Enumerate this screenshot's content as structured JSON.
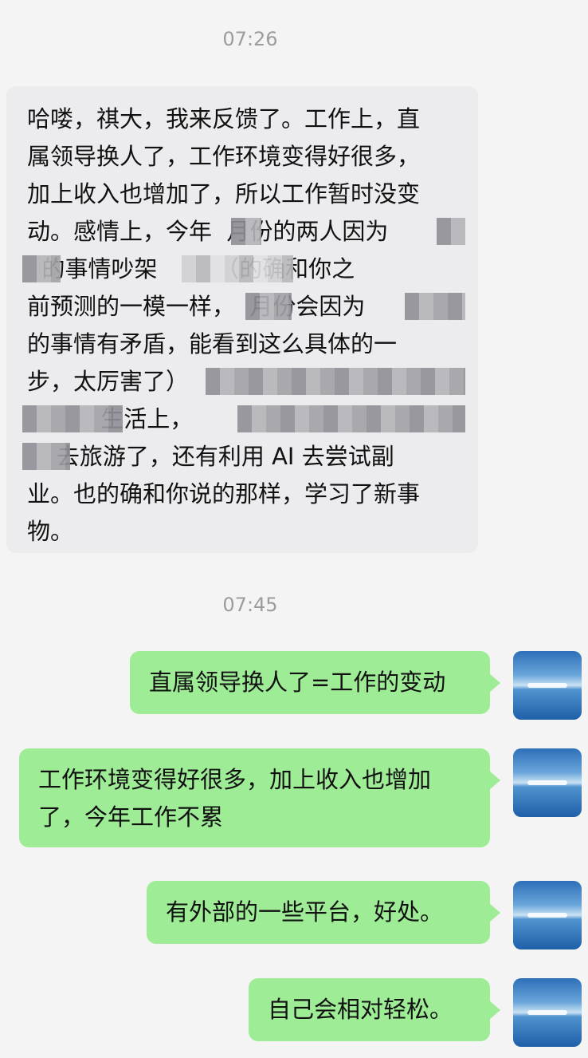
{
  "messages": [
    {
      "timestamp": "07:26",
      "text_lines": [
        "哈喽，祺大，我来反馈了。工作上，直",
        "属领导换人了，工作环境变得好很多，",
        "加上收入也增加了，所以工作暂时没变",
        "动。感情上，今年  月份的两人因为",
        "  的事情吵架        （的确和你之",
        "前预测的一模一样，  月份会因为",
        "的事情有矛盾，能看到这么具体的一",
        "步，太厉害了）",
        "          生活上，",
        "    去旅游了，还有利用 AI 去尝试副",
        "业。也的确和你说的那样，学习了新事",
        "物。"
      ]
    }
  ],
  "timestamp2": "07:45",
  "replies": [
    {
      "text": "直属领导换人了=工作的变动"
    },
    {
      "text_lines": [
        "工作环境变得好很多，加上收入也增加",
        "了，今年工作不累"
      ]
    },
    {
      "text": "有外部的一些平台，好处。"
    },
    {
      "text": "自己会相对轻松。"
    }
  ],
  "icons": {
    "avatar": "sea-avatar-icon"
  },
  "colors": {
    "background": "#f4f4f4",
    "incoming_bubble": "#ececef",
    "outgoing_bubble": "#9eec96",
    "timestamp": "#9c9c9c"
  }
}
